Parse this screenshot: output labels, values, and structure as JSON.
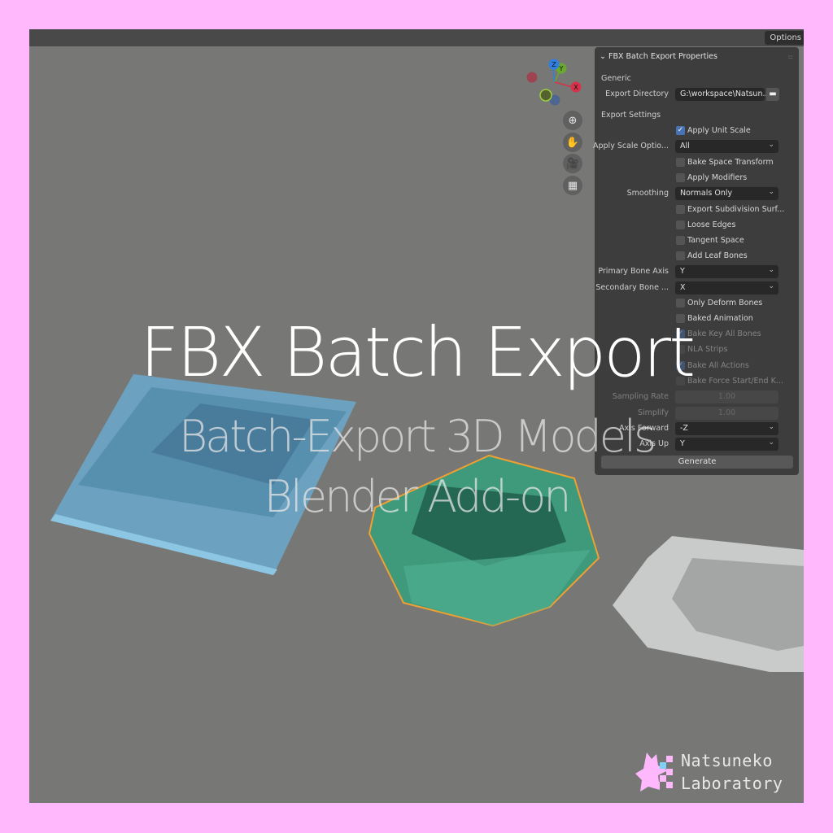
{
  "header": {
    "options_label": "Options"
  },
  "gizmo": {
    "axes": [
      {
        "name": "Z",
        "color": "#2f7fe0"
      },
      {
        "name": "Y",
        "color": "#6aa82f"
      },
      {
        "name": "X",
        "color": "#d6334a"
      }
    ]
  },
  "nav_buttons": [
    "zoom-icon",
    "hand-pan-icon",
    "camera-icon",
    "grid-icon"
  ],
  "panel": {
    "title": "FBX Batch Export Properties",
    "generic_label": "Generic",
    "export_directory": {
      "label": "Export Directory",
      "value": "G:\\workspace\\Natsun..."
    },
    "export_settings_label": "Export Settings",
    "apply_unit_scale": {
      "label": "Apply Unit Scale",
      "checked": true
    },
    "apply_scale_options": {
      "label": "Apply Scale Optio...",
      "value": "All"
    },
    "bake_space_transform": {
      "label": "Bake Space Transform",
      "checked": false
    },
    "apply_modifiers": {
      "label": "Apply Modifiers",
      "checked": false
    },
    "smoothing": {
      "label": "Smoothing",
      "value": "Normals Only"
    },
    "export_subdivision": {
      "label": "Export Subdivision Surf...",
      "checked": false
    },
    "loose_edges": {
      "label": "Loose Edges",
      "checked": false
    },
    "tangent_space": {
      "label": "Tangent Space",
      "checked": false
    },
    "add_leaf_bones": {
      "label": "Add Leaf Bones",
      "checked": false
    },
    "primary_bone_axis": {
      "label": "Primary Bone Axis",
      "value": "Y"
    },
    "secondary_bone_axis": {
      "label": "Secondary Bone ...",
      "value": "X"
    },
    "only_deform_bones": {
      "label": "Only Deform Bones",
      "checked": false
    },
    "baked_animation": {
      "label": "Baked Animation",
      "checked": false
    },
    "bake_key_all_bones": {
      "label": "Bake Key All Bones",
      "checked": true
    },
    "nla_strips": {
      "label": "NLA Strips",
      "checked": false
    },
    "bake_all_actions": {
      "label": "Bake All Actions",
      "checked": true
    },
    "bake_force_start_end": {
      "label": "Bake Force Start/End K...",
      "checked": false
    },
    "sampling_rate": {
      "label": "Sampling Rate",
      "value": "1.00"
    },
    "simplify": {
      "label": "Simplify",
      "value": "1.00"
    },
    "axis_forward": {
      "label": "Axis Forward",
      "value": "-Z"
    },
    "axis_up": {
      "label": "Axis Up",
      "value": "Y"
    },
    "generate_label": "Generate"
  },
  "overlay": {
    "title": "FBX Batch Export",
    "subtitle": "Batch-Export 3D Models",
    "tagline": "Blender Add-on"
  },
  "brand": {
    "line1": "Natsuneko",
    "line2": "Laboratory",
    "accent": "#ffb8fc"
  },
  "colors": {
    "border": "#ffb8fc",
    "viewport": "#777876",
    "selection": "#f0a030"
  }
}
